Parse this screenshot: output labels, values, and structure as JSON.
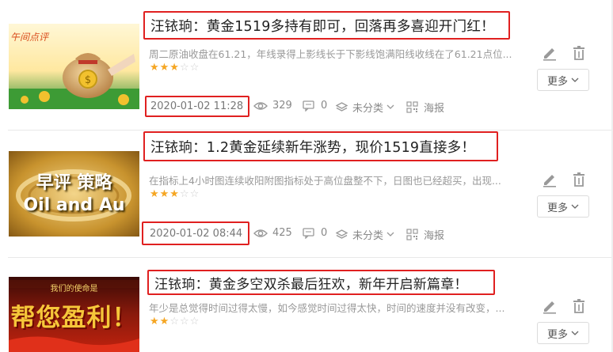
{
  "articles": [
    {
      "title": "汪铱珦：黄金1519多持有即可，回落再多喜迎开门红！",
      "summary": "周二原油收盘在61.21，年线录得上影线长于下影线饱满阳线收线在了61.21点位...",
      "rating": 3,
      "date": "2020-01-02 11:28",
      "views": "329",
      "comments": "0",
      "category": "未分类",
      "poster": "海报",
      "more": "更多",
      "thumb_text": "午间点评"
    },
    {
      "title": "汪铱珦：1.2黄金延续新年涨势，现价1519直接多！",
      "summary": "在指标上4小时图连续收阳附图指标处于高位盘整不下，日图也已经超买，出现...",
      "rating": 3,
      "date": "2020-01-02 08:44",
      "views": "425",
      "comments": "0",
      "category": "未分类",
      "poster": "海报",
      "more": "更多",
      "thumb_line1": "早评 策略",
      "thumb_line2": "Oil and Au"
    },
    {
      "title": "汪铱珦：黄金多空双杀最后狂欢，新年开启新篇章！",
      "summary": "年少是总觉得时间过得太慢，如今感觉时间过得太快，时间的速度并没有改变，...",
      "rating": 2,
      "more": "更多",
      "thumb_small": "我们的使命是",
      "thumb_big": "帮您盈利！"
    }
  ],
  "colors": {
    "highlight": "#e02020",
    "star": "#f5a623",
    "muted": "#999999"
  },
  "icons": [
    "edit-icon",
    "trash-icon",
    "eye-icon",
    "comment-icon",
    "layers-icon",
    "qrcode-icon",
    "chevron-down-icon"
  ]
}
